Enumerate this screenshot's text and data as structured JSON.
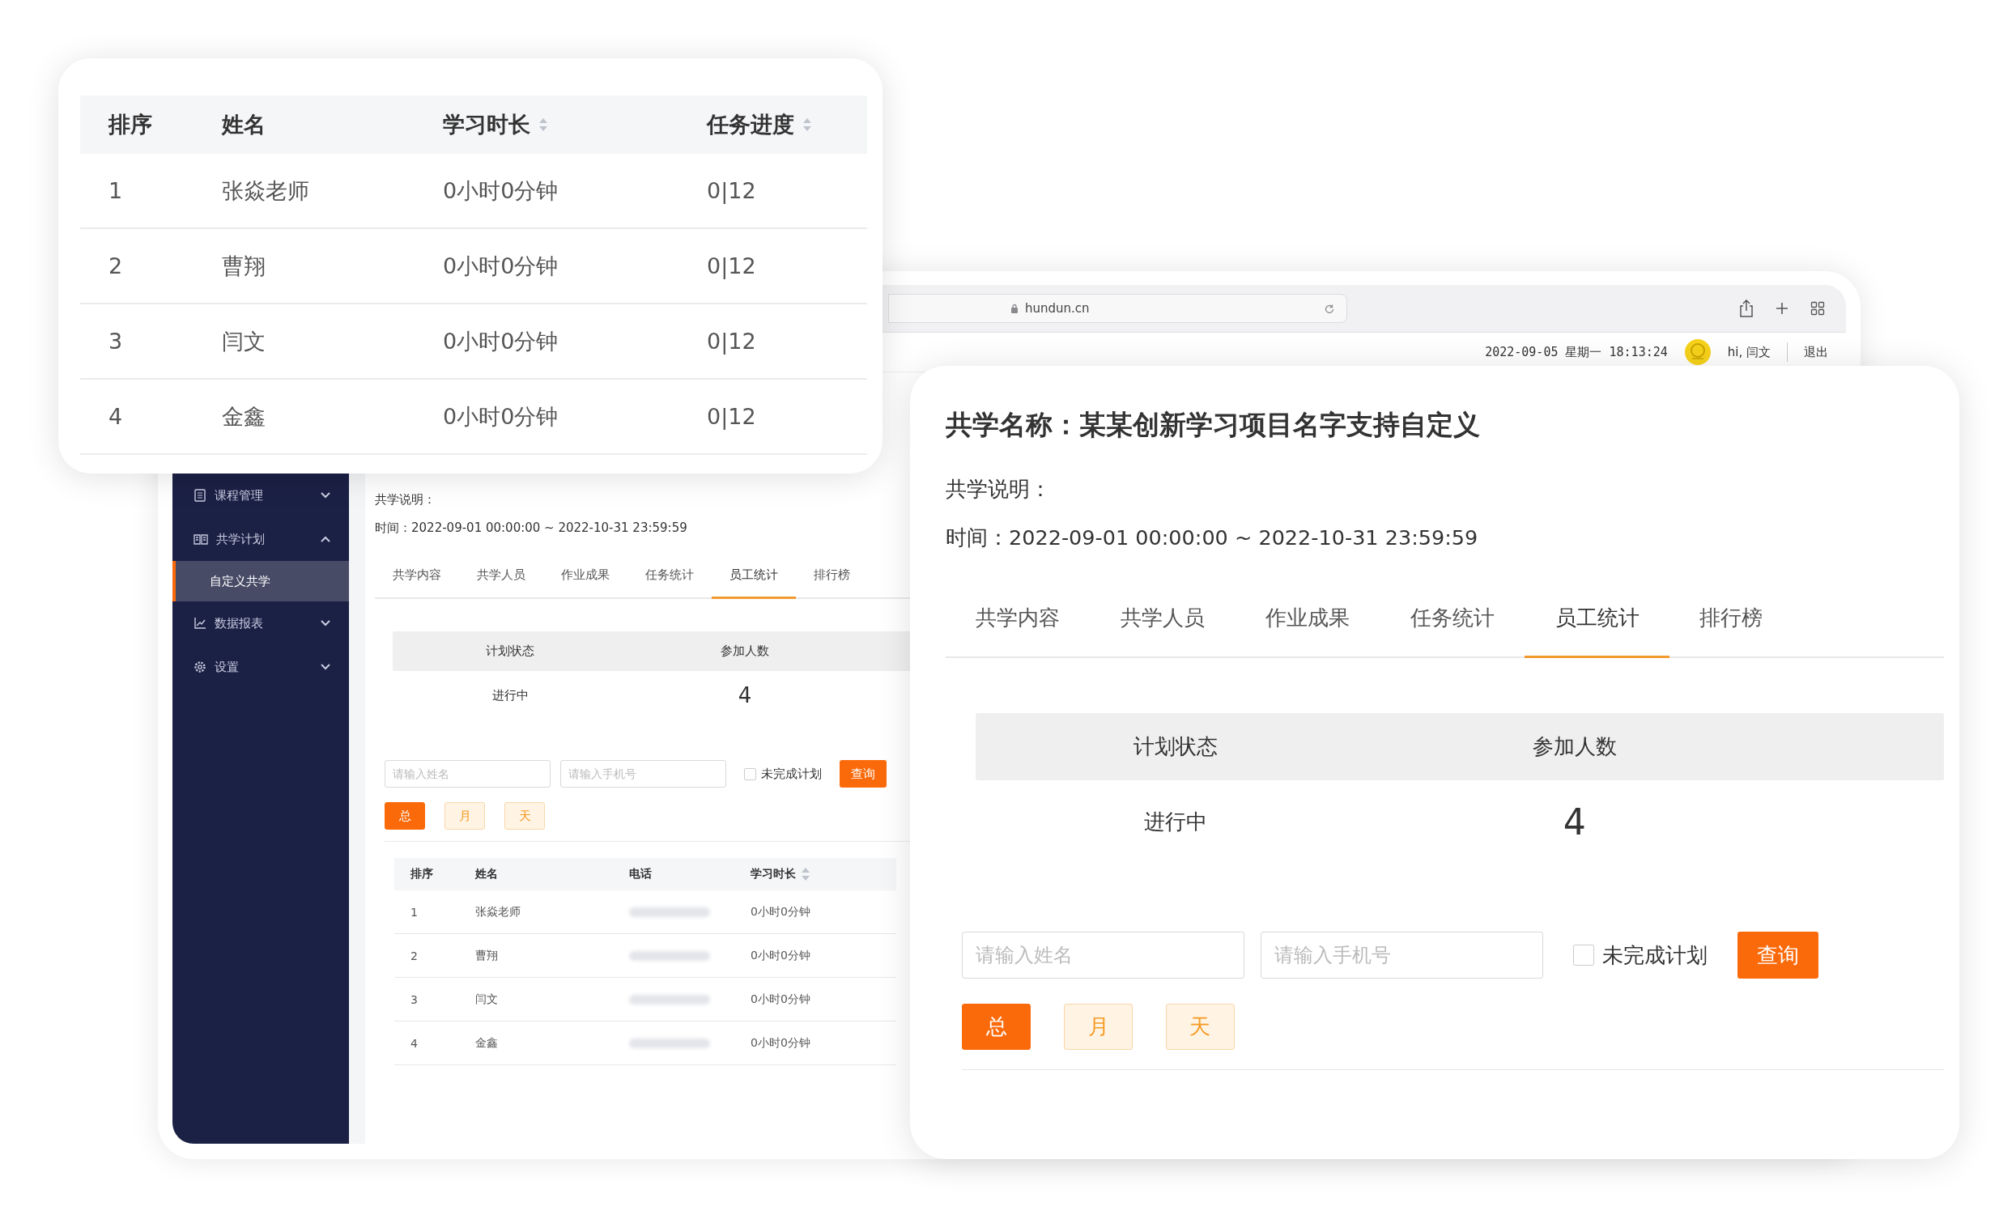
{
  "ranking_card": {
    "columns": [
      {
        "label": "排序",
        "sortable": false
      },
      {
        "label": "姓名",
        "sortable": false
      },
      {
        "label": "学习时长",
        "sortable": true
      },
      {
        "label": "任务进度",
        "sortable": true
      }
    ],
    "rows": [
      {
        "rank": "1",
        "name": "张焱老师",
        "duration": "0小时0分钟",
        "progress": "0|12"
      },
      {
        "rank": "2",
        "name": "曹翔",
        "duration": "0小时0分钟",
        "progress": "0|12"
      },
      {
        "rank": "3",
        "name": "闫文",
        "duration": "0小时0分钟",
        "progress": "0|12"
      },
      {
        "rank": "4",
        "name": "金鑫",
        "duration": "0小时0分钟",
        "progress": "0|12"
      }
    ]
  },
  "browser": {
    "url": "hundun.cn",
    "datetime": "2022-09-05 星期一 18:13:24",
    "greeting": "hi, 闫文",
    "logout": "退出",
    "sidebar": [
      {
        "label": "课程管理",
        "expanded": false
      },
      {
        "label": "共学计划",
        "expanded": true,
        "children": [
          {
            "label": "自定义共学",
            "selected": true
          }
        ]
      },
      {
        "label": "数据报表",
        "expanded": false
      },
      {
        "label": "设置",
        "expanded": false
      }
    ],
    "content": {
      "description_label": "共学说明：",
      "time": "时间：2022-09-01 00:00:00 ~ 2022-10-31 23:59:59",
      "tabs": [
        {
          "label": "共学内容",
          "selected": false
        },
        {
          "label": "共学人员",
          "selected": false
        },
        {
          "label": "作业成果",
          "selected": false
        },
        {
          "label": "任务统计",
          "selected": false
        },
        {
          "label": "员工统计",
          "selected": true
        },
        {
          "label": "排行榜",
          "selected": false
        }
      ],
      "summary": {
        "columns": [
          "计划状态",
          "参加人数"
        ],
        "values": [
          "进行中",
          "4"
        ]
      },
      "name_placeholder": "请输入姓名",
      "phone_placeholder": "请输入手机号",
      "incomplete_filter": {
        "label": "未完成计划",
        "checked": false
      },
      "query_button": "查询",
      "periods": [
        {
          "label": "总",
          "selected": true
        },
        {
          "label": "月",
          "selected": false
        },
        {
          "label": "天",
          "selected": false
        }
      ],
      "table": {
        "columns": [
          {
            "label": "排序",
            "sortable": false
          },
          {
            "label": "姓名",
            "sortable": false
          },
          {
            "label": "电话",
            "sortable": false
          },
          {
            "label": "学习时长",
            "sortable": true
          }
        ],
        "rows": [
          {
            "rank": "1",
            "name": "张焱老师",
            "duration": "0小时0分钟"
          },
          {
            "rank": "2",
            "name": "曹翔",
            "duration": "0小时0分钟"
          },
          {
            "rank": "3",
            "name": "闫文",
            "duration": "0小时0分钟"
          },
          {
            "rank": "4",
            "name": "金鑫",
            "duration": "0小时0分钟"
          }
        ]
      }
    }
  },
  "detail_card": {
    "title": "共学名称：某某创新学习项目名字支持自定义",
    "description_label": "共学说明：",
    "time": "时间：2022-09-01 00:00:00 ~ 2022-10-31 23:59:59",
    "tabs": [
      {
        "label": "共学内容",
        "selected": false
      },
      {
        "label": "共学人员",
        "selected": false
      },
      {
        "label": "作业成果",
        "selected": false
      },
      {
        "label": "任务统计",
        "selected": false
      },
      {
        "label": "员工统计",
        "selected": true
      },
      {
        "label": "排行榜",
        "selected": false
      }
    ],
    "summary": {
      "columns": [
        "计划状态",
        "参加人数"
      ],
      "values": [
        "进行中",
        "4"
      ]
    },
    "name_placeholder": "请输入姓名",
    "phone_placeholder": "请输入手机号",
    "incomplete_filter": {
      "label": "未完成计划",
      "checked": false
    },
    "query_button": "查询",
    "periods": [
      {
        "label": "总",
        "selected": true
      },
      {
        "label": "月",
        "selected": false
      },
      {
        "label": "天",
        "selected": false
      }
    ]
  }
}
